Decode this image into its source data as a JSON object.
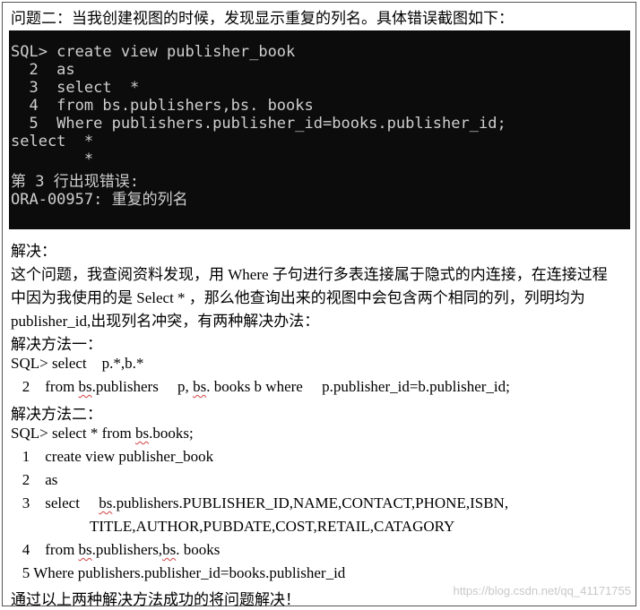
{
  "heading": "问题二：当我创建视图的时候，发现显示重复的列名。具体错误截图如下：",
  "terminal": {
    "lines": [
      "SQL> create view publisher_book",
      "  2  as",
      "  3  select  *",
      "  4  from bs.publishers,bs. books",
      "  5  Where publishers.publisher_id=books.publisher_id;",
      "select  *",
      "        *",
      "第 3 行出现错误:",
      "ORA-00957: 重复的列名"
    ]
  },
  "solution_label": "解决：",
  "explanation": {
    "line1": "这个问题，我查阅资料发现，用 Where 子句进行多表连接属于隐式的内连接，在连接过程",
    "line2": "中因为我使用的是 Select * ，那么他查询出来的视图中会包含两个相同的列，列明均为",
    "line3": "publisher_id,出现列名冲突，有两种解决办法："
  },
  "method1": {
    "title": "解决方法一：",
    "line1": "SQL> select    p.*,b.*",
    "line2_a": "   2    from ",
    "line2_b": "bs",
    "line2_c": ".publishers     p, ",
    "line2_d": "bs",
    "line2_e": ". books b where     p.publisher_id=b.publisher_id;"
  },
  "method2": {
    "title": "解决方法二：",
    "line1_a": "SQL> select * from ",
    "line1_b": "bs",
    "line1_c": ".books;",
    "line2": "   1    create view publisher_book",
    "line3": "   2    as",
    "line4_a": "   3    select     ",
    "line4_b": "bs",
    "line4_c": ".publishers.PUBLISHER_ID,NAME,CONTACT,PHONE,ISBN,",
    "line5": "TITLE,AUTHOR,PUBDATE,COST,RETAIL,CATAGORY",
    "line6_a": "   4    from ",
    "line6_b": "bs",
    "line6_c": ".publishers,",
    "line6_d": "bs",
    "line6_e": ". books",
    "line7": "   5 Where publishers.publisher_id=books.publisher_id"
  },
  "conclusion": "通过以上两种解决方法成功的将问题解决！",
  "watermark": "https://blog.csdn.net/qq_41171755"
}
